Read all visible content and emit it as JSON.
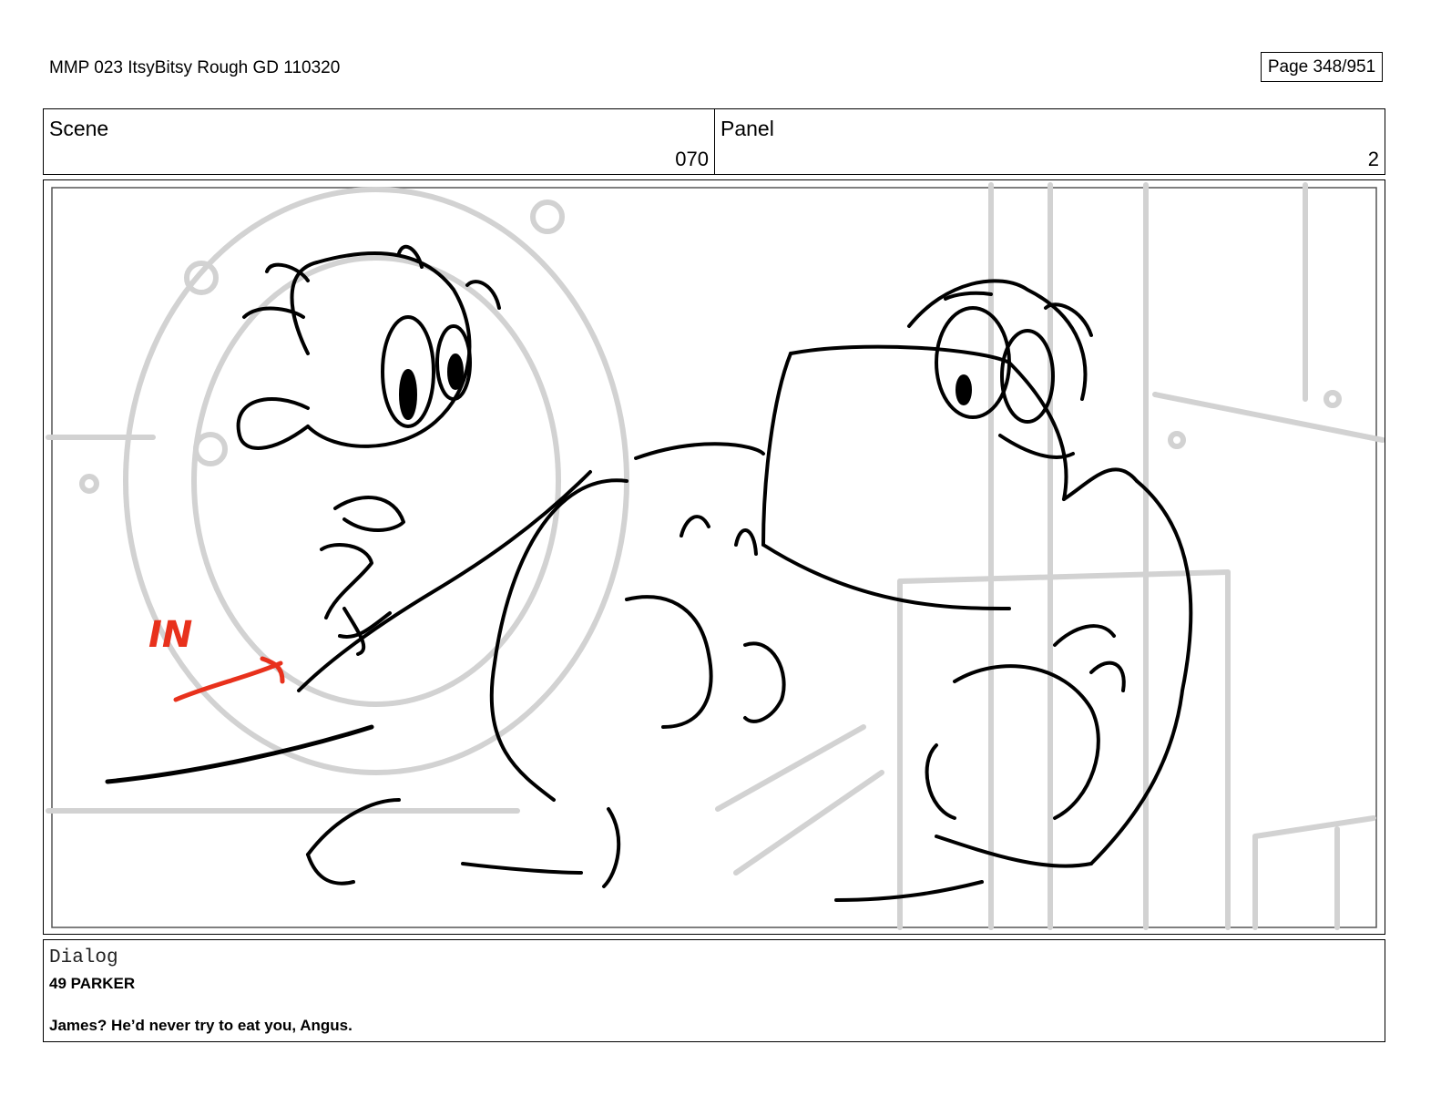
{
  "header": {
    "document_title": "MMP 023 ItsyBitsy Rough GD 110320",
    "page_label": "Page 348/951"
  },
  "scene": {
    "label": "Scene",
    "value": "070"
  },
  "panel": {
    "label": "Panel",
    "value": "2"
  },
  "frame": {
    "annotation_text": "IN",
    "colors": {
      "annotation": "#e8311c",
      "sketch_background": "#d2d2d2",
      "ink": "#000000"
    }
  },
  "dialog": {
    "label": "Dialog",
    "speaker": "49 PARKER",
    "line": "James? He’d never try to eat you, Angus."
  }
}
